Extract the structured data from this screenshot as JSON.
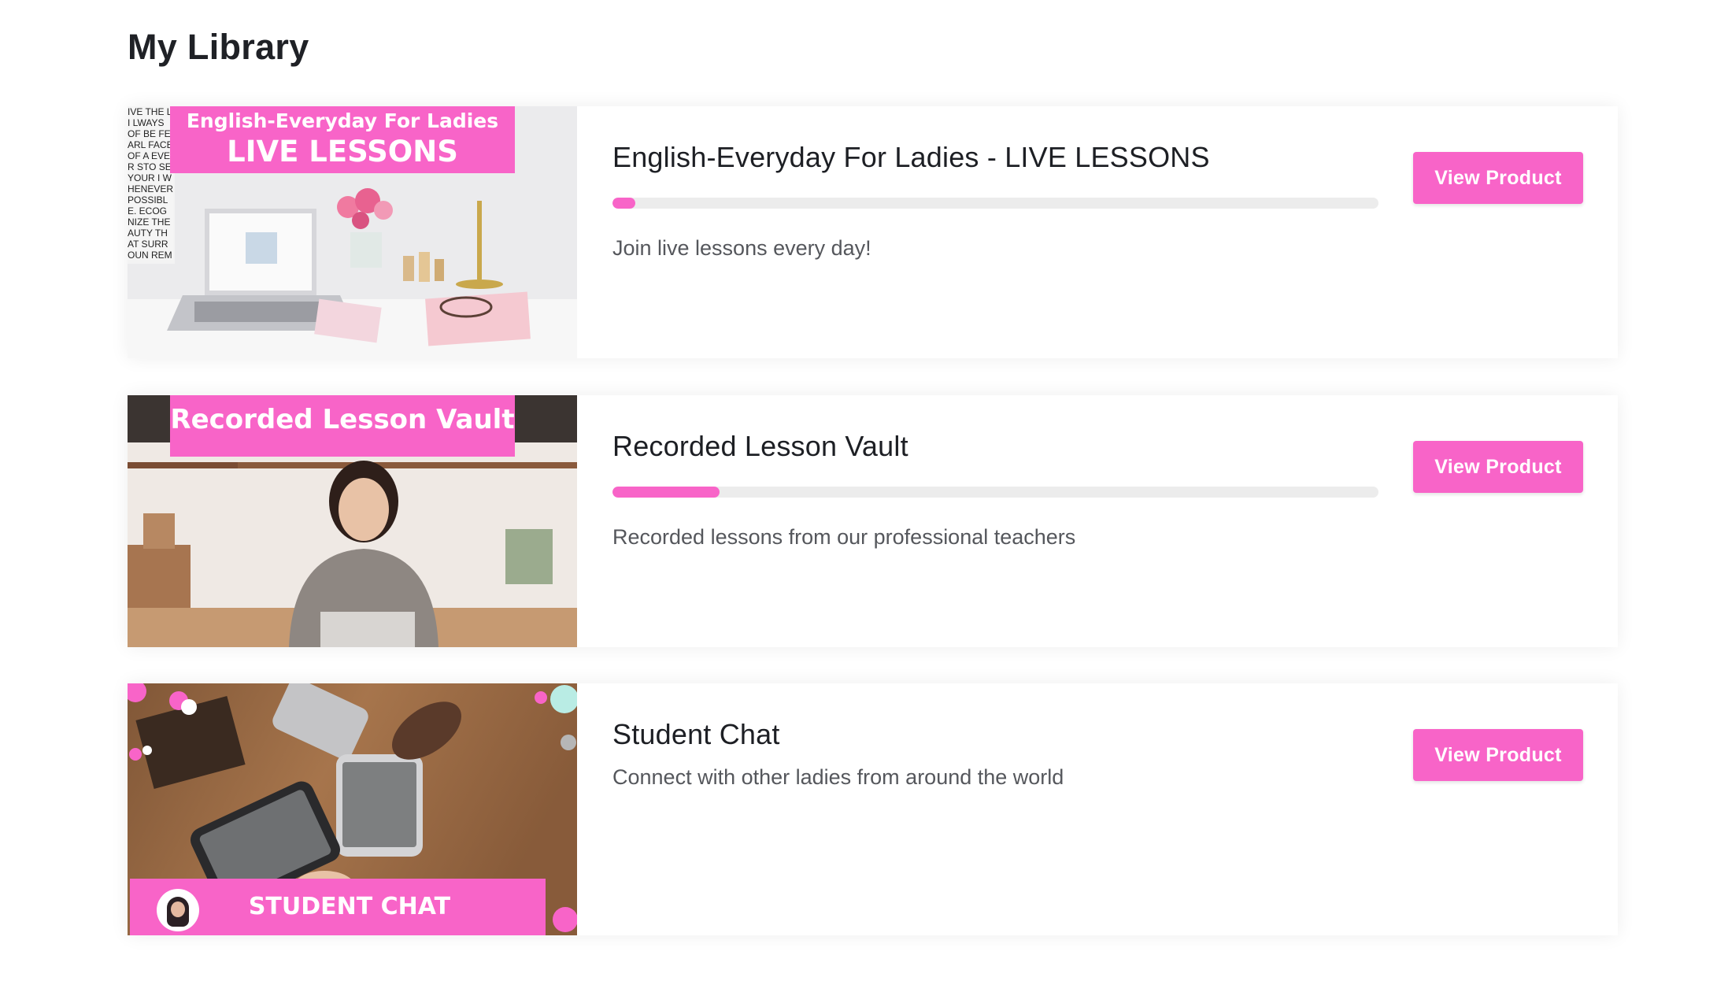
{
  "page": {
    "title": "My Library"
  },
  "colors": {
    "accent": "#f864c8",
    "track": "#ececec",
    "title_text": "#1d1f24",
    "desc_text": "#55575c"
  },
  "products": [
    {
      "title": "English-Everyday For Ladies - LIVE LESSONS",
      "description": "Join live lessons every day!",
      "progress": 0.03,
      "button_label": "View Product",
      "thumbnail": {
        "banner_line1": "English-Everyday For Ladies",
        "banner_line2": "LIVE LESSONS",
        "poster_text": "IVE THE LI LWAYS OF BE FEARL FACE OF A EVER STO SE YOUR I WHENEVER POSSIBLE. ECOGNIZE THE AUTY THAT SURROUN REMEMBER WHE AME FROM, BU LOSE SIGHT OF YOU ARE GO"
      }
    },
    {
      "title": "Recorded Lesson Vault",
      "description": "Recorded lessons from our professional teachers",
      "progress": 0.14,
      "button_label": "View Product",
      "thumbnail": {
        "banner_line1": "Recorded Lesson Vault"
      }
    },
    {
      "title": "Student Chat",
      "description": "Connect with other ladies from around the world",
      "button_label": "View Product",
      "thumbnail": {
        "banner_line1": "STUDENT CHAT"
      }
    }
  ]
}
